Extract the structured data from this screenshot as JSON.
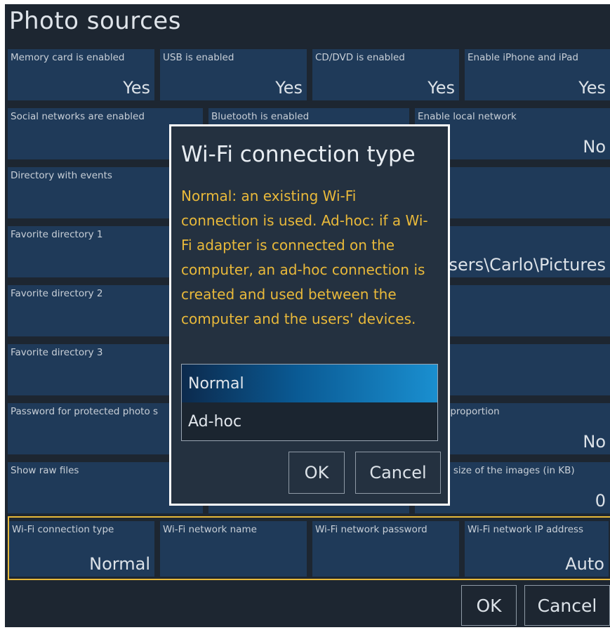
{
  "page": {
    "title": "Photo sources"
  },
  "tiles": {
    "memory_card": {
      "label": "Memory card is enabled",
      "value": "Yes"
    },
    "usb": {
      "label": "USB is enabled",
      "value": "Yes"
    },
    "cddvd": {
      "label": "CD/DVD is enabled",
      "value": "Yes"
    },
    "iphone": {
      "label": "Enable iPhone and iPad",
      "value": "Yes"
    },
    "social": {
      "label": "Social networks are enabled",
      "value": ""
    },
    "bluetooth": {
      "label": "Bluetooth is enabled",
      "value": ""
    },
    "local_network": {
      "label": "Enable local network",
      "value": "No"
    },
    "directory_events": {
      "label": "Directory with events",
      "value": ""
    },
    "favorite_1": {
      "label": "Favorite directory 1",
      "value": "sers\\Carlo\\Pictures"
    },
    "favorite_2": {
      "label": "Favorite directory 2",
      "value": ""
    },
    "favorite_3": {
      "label": "Favorite directory 3",
      "value": ""
    },
    "password_protected": {
      "label": "Password for protected photo s",
      "value": ""
    },
    "image_proportion": {
      "label": "image proportion",
      "value": "No"
    },
    "show_raw": {
      "label": "Show raw files",
      "value": ""
    },
    "max_file_size": {
      "label": "um file size of the images (in KB)",
      "value": "0"
    },
    "wifi_type": {
      "label": "Wi-Fi connection type",
      "value": "Normal"
    },
    "wifi_name": {
      "label": "Wi-Fi network name",
      "value": ""
    },
    "wifi_password": {
      "label": "Wi-Fi network password",
      "value": ""
    },
    "wifi_ip": {
      "label": "Wi-Fi network IP address",
      "value": "Auto"
    }
  },
  "footer": {
    "ok_label": "OK",
    "cancel_label": "Cancel"
  },
  "dialog": {
    "title": "Wi-Fi connection type",
    "description": "Normal: an existing Wi-Fi connection is used. Ad-hoc: if a Wi-Fi adapter is connected on the computer, an ad-hoc connection is created and used between the computer and the users' devices.",
    "options": [
      {
        "label": "Normal",
        "selected": true
      },
      {
        "label": "Ad-hoc",
        "selected": false
      }
    ],
    "ok_label": "OK",
    "cancel_label": "Cancel"
  },
  "colors": {
    "background": "#1d2631",
    "tile": "#1f3a59",
    "accent_yellow": "#e7b93a",
    "selected_blue": "#1a8fd0"
  }
}
